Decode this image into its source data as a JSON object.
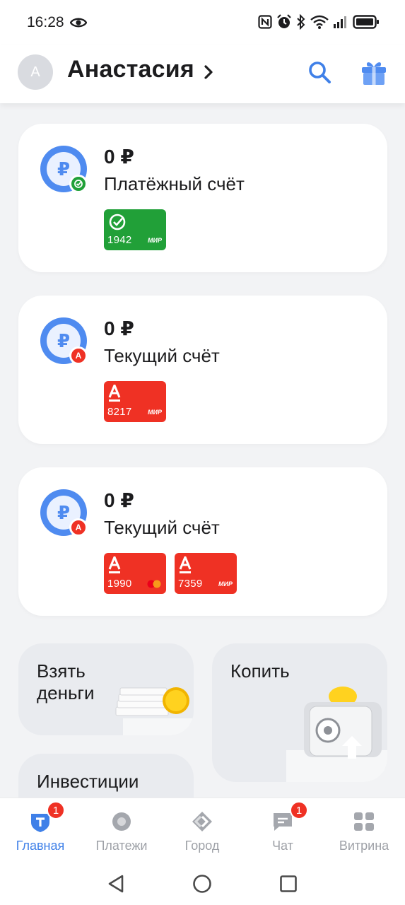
{
  "status_bar": {
    "time": "16:28",
    "icons": [
      "eye-icon",
      "nfc-icon",
      "alarm-icon",
      "bluetooth-icon",
      "wifi-icon",
      "signal-icon",
      "battery-icon"
    ]
  },
  "header": {
    "avatar_initial": "А",
    "user_name": "Анастасия",
    "colors": {
      "accent": "#3f80e8",
      "avatar_bg": "#d9dbe0"
    }
  },
  "accounts": [
    {
      "balance": "0 ₽",
      "title": "Платёжный счёт",
      "badge": "green",
      "cards": [
        {
          "number": "1942",
          "system": "МИР",
          "color": "#21a038"
        }
      ]
    },
    {
      "balance": "0 ₽",
      "title": "Текущий счёт",
      "badge": "red",
      "cards": [
        {
          "number": "8217",
          "system": "МИР",
          "color": "#ef3124"
        }
      ]
    },
    {
      "balance": "0 ₽",
      "title": "Текущий счёт",
      "badge": "red",
      "cards": [
        {
          "number": "1990",
          "system": "mastercard",
          "color": "#ef3124"
        },
        {
          "number": "7359",
          "system": "МИР",
          "color": "#ef3124"
        }
      ]
    }
  ],
  "tiles": {
    "borrow": {
      "line1": "Взять",
      "line2": "деньги"
    },
    "save": {
      "label": "Копить"
    },
    "invest": {
      "line1": "Инвестиции"
    }
  },
  "bottom_nav": [
    {
      "label": "Главная",
      "active": true,
      "badge": "1"
    },
    {
      "label": "Платежи",
      "active": false
    },
    {
      "label": "Город",
      "active": false
    },
    {
      "label": "Чат",
      "active": false,
      "badge": "1"
    },
    {
      "label": "Витрина",
      "active": false
    }
  ]
}
